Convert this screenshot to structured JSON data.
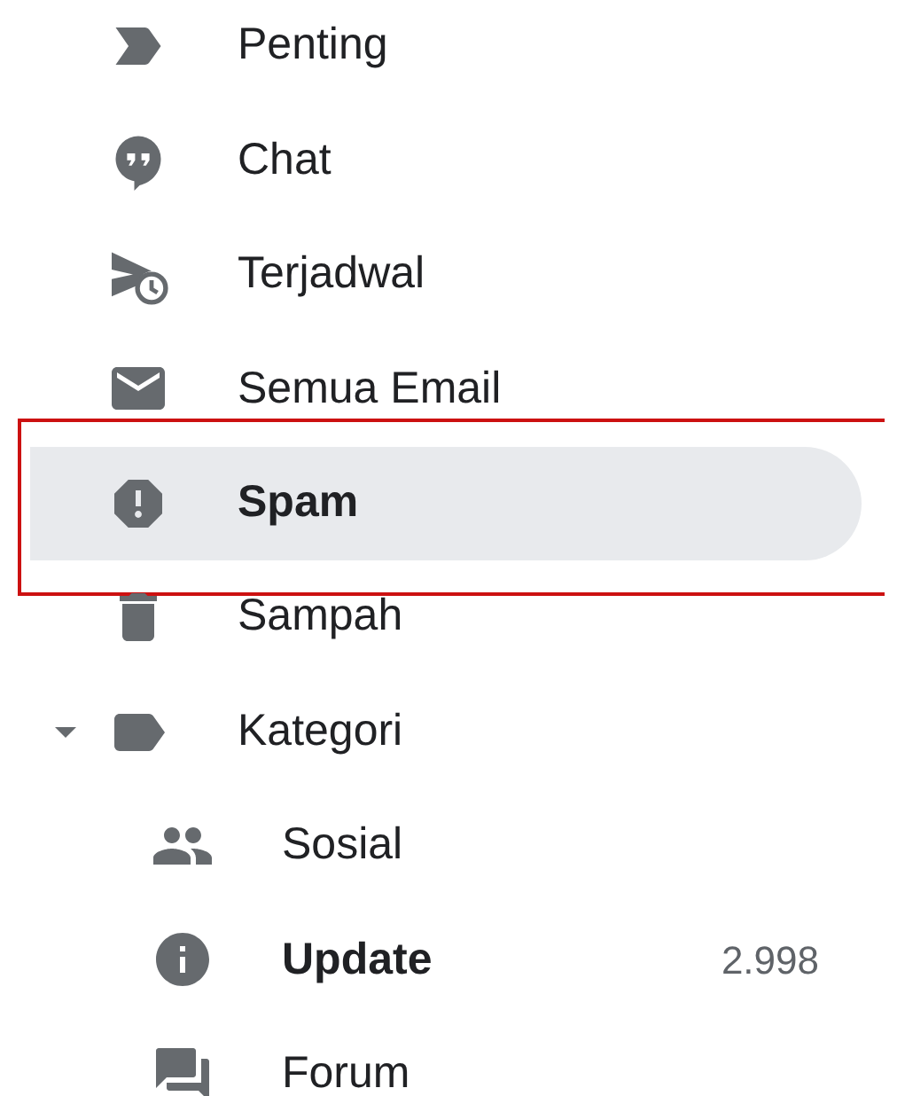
{
  "sidebar": {
    "items": [
      {
        "label": "Penting",
        "selected": false,
        "bold": false
      },
      {
        "label": "Chat",
        "selected": false,
        "bold": false
      },
      {
        "label": "Terjadwal",
        "selected": false,
        "bold": false
      },
      {
        "label": "Semua Email",
        "selected": false,
        "bold": false
      },
      {
        "label": "Spam",
        "selected": true,
        "bold": true,
        "highlighted": true
      },
      {
        "label": "Sampah",
        "selected": false,
        "bold": false
      },
      {
        "label": "Kategori",
        "selected": false,
        "bold": false,
        "expanded": true,
        "children": [
          {
            "label": "Sosial",
            "selected": false,
            "bold": false
          },
          {
            "label": "Update",
            "selected": false,
            "bold": true,
            "count": "2.998"
          },
          {
            "label": "Forum",
            "selected": false,
            "bold": false
          }
        ]
      }
    ]
  }
}
